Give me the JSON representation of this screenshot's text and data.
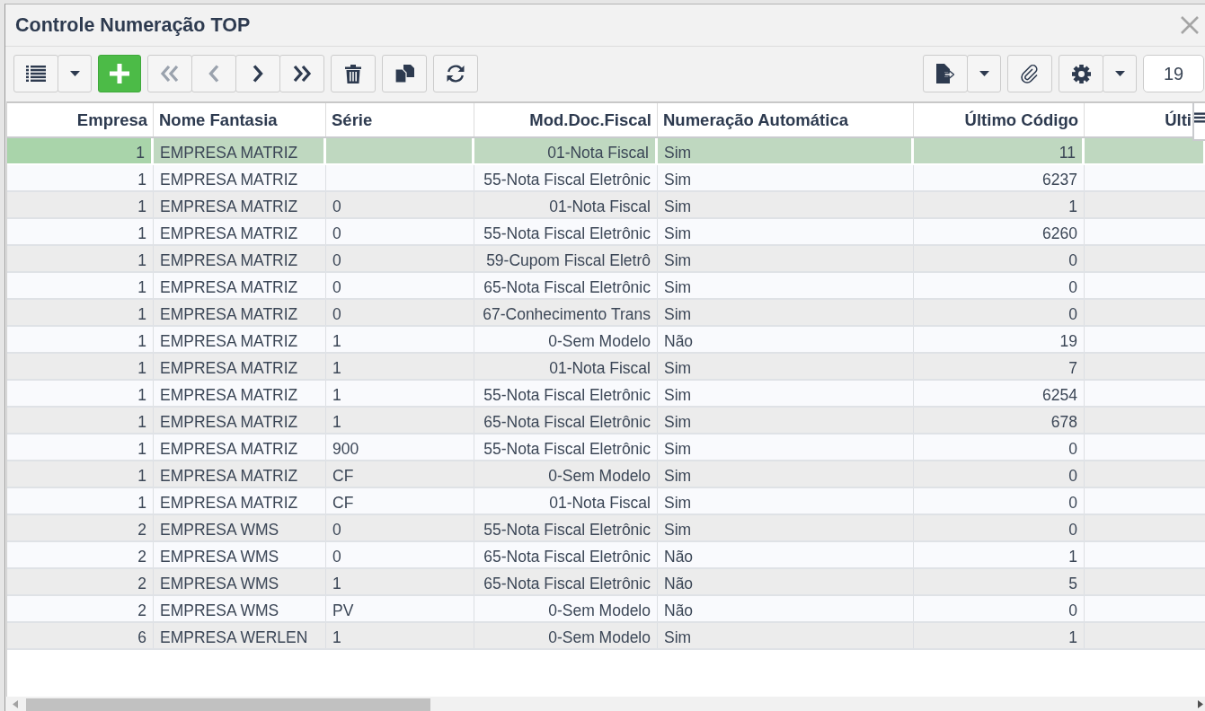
{
  "window": {
    "title": "Controle Numeração TOP"
  },
  "toolbar": {
    "navigation": [
      {
        "disabled": true
      },
      {
        "disabled": true
      },
      {
        "disabled": false
      },
      {
        "disabled": false
      }
    ],
    "count_field": {
      "value": "19"
    }
  },
  "table": {
    "columns": [
      {
        "label": "Empresa",
        "kind": "number"
      },
      {
        "label": "Nome Fantasia",
        "kind": "text"
      },
      {
        "label": "Série",
        "kind": "text"
      },
      {
        "label": "Mod.Doc.Fiscal",
        "kind": "lookup"
      },
      {
        "label": "Numeração Automática",
        "kind": "text"
      },
      {
        "label": "Último Código",
        "kind": "number"
      },
      {
        "label": "Últi",
        "kind": "number"
      }
    ],
    "rows": [
      {
        "selected": true,
        "empresa": "1",
        "nome_fantasia": "EMPRESA MATRIZ",
        "mod_doc_fiscal": "01-Nota Fiscal",
        "numeracao_automatica": "Sim",
        "ultimo_codigo": "11"
      },
      {
        "selected": false,
        "empresa": "1",
        "nome_fantasia": "EMPRESA MATRIZ",
        "mod_doc_fiscal": "55-Nota Fiscal Eletrônic",
        "numeracao_automatica": "Sim",
        "ultimo_codigo": "6237"
      },
      {
        "selected": false,
        "empresa": "1",
        "nome_fantasia": "EMPRESA MATRIZ",
        "serie": "0",
        "mod_doc_fiscal": "01-Nota Fiscal",
        "numeracao_automatica": "Sim",
        "ultimo_codigo": "1"
      },
      {
        "selected": false,
        "empresa": "1",
        "nome_fantasia": "EMPRESA MATRIZ",
        "serie": "0",
        "mod_doc_fiscal": "55-Nota Fiscal Eletrônic",
        "numeracao_automatica": "Sim",
        "ultimo_codigo": "6260"
      },
      {
        "selected": false,
        "empresa": "1",
        "nome_fantasia": "EMPRESA MATRIZ",
        "serie": "0",
        "mod_doc_fiscal": "59-Cupom Fiscal Eletrô",
        "numeracao_automatica": "Sim",
        "ultimo_codigo": "0"
      },
      {
        "selected": false,
        "empresa": "1",
        "nome_fantasia": "EMPRESA MATRIZ",
        "serie": "0",
        "mod_doc_fiscal": "65-Nota Fiscal Eletrônic",
        "numeracao_automatica": "Sim",
        "ultimo_codigo": "0"
      },
      {
        "selected": false,
        "empresa": "1",
        "nome_fantasia": "EMPRESA MATRIZ",
        "serie": "0",
        "mod_doc_fiscal": "67-Conhecimento Trans",
        "numeracao_automatica": "Sim",
        "ultimo_codigo": "0"
      },
      {
        "selected": false,
        "empresa": "1",
        "nome_fantasia": "EMPRESA MATRIZ",
        "serie": "1",
        "mod_doc_fiscal": "0-Sem Modelo",
        "numeracao_automatica": "Não",
        "ultimo_codigo": "19"
      },
      {
        "selected": false,
        "empresa": "1",
        "nome_fantasia": "EMPRESA MATRIZ",
        "serie": "1",
        "mod_doc_fiscal": "01-Nota Fiscal",
        "numeracao_automatica": "Sim",
        "ultimo_codigo": "7"
      },
      {
        "selected": false,
        "empresa": "1",
        "nome_fantasia": "EMPRESA MATRIZ",
        "serie": "1",
        "mod_doc_fiscal": "55-Nota Fiscal Eletrônic",
        "numeracao_automatica": "Sim",
        "ultimo_codigo": "6254"
      },
      {
        "selected": false,
        "empresa": "1",
        "nome_fantasia": "EMPRESA MATRIZ",
        "serie": "1",
        "mod_doc_fiscal": "65-Nota Fiscal Eletrônic",
        "numeracao_automatica": "Sim",
        "ultimo_codigo": "678"
      },
      {
        "selected": false,
        "empresa": "1",
        "nome_fantasia": "EMPRESA MATRIZ",
        "serie": "900",
        "mod_doc_fiscal": "55-Nota Fiscal Eletrônic",
        "numeracao_automatica": "Sim",
        "ultimo_codigo": "0"
      },
      {
        "selected": false,
        "empresa": "1",
        "nome_fantasia": "EMPRESA MATRIZ",
        "serie": "CF",
        "mod_doc_fiscal": "0-Sem Modelo",
        "numeracao_automatica": "Sim",
        "ultimo_codigo": "0"
      },
      {
        "selected": false,
        "empresa": "1",
        "nome_fantasia": "EMPRESA MATRIZ",
        "serie": "CF",
        "mod_doc_fiscal": "01-Nota Fiscal",
        "numeracao_automatica": "Sim",
        "ultimo_codigo": "0"
      },
      {
        "selected": false,
        "empresa": "2",
        "nome_fantasia": "EMPRESA WMS",
        "serie": "0",
        "mod_doc_fiscal": "55-Nota Fiscal Eletrônic",
        "numeracao_automatica": "Sim",
        "ultimo_codigo": "0"
      },
      {
        "selected": false,
        "empresa": "2",
        "nome_fantasia": "EMPRESA WMS",
        "serie": "0",
        "mod_doc_fiscal": "65-Nota Fiscal Eletrônic",
        "numeracao_automatica": "Não",
        "ultimo_codigo": "1"
      },
      {
        "selected": false,
        "empresa": "2",
        "nome_fantasia": "EMPRESA WMS",
        "serie": "1",
        "mod_doc_fiscal": "65-Nota Fiscal Eletrônic",
        "numeracao_automatica": "Não",
        "ultimo_codigo": "5"
      },
      {
        "selected": false,
        "empresa": "2",
        "nome_fantasia": "EMPRESA WMS",
        "serie": "PV",
        "mod_doc_fiscal": "0-Sem Modelo",
        "numeracao_automatica": "Não",
        "ultimo_codigo": "0"
      },
      {
        "selected": false,
        "empresa": "6",
        "nome_fantasia": "EMPRESA WERLEN",
        "serie": "1",
        "mod_doc_fiscal": "0-Sem Modelo",
        "numeracao_automatica": "Sim",
        "ultimo_codigo": "1"
      }
    ]
  }
}
